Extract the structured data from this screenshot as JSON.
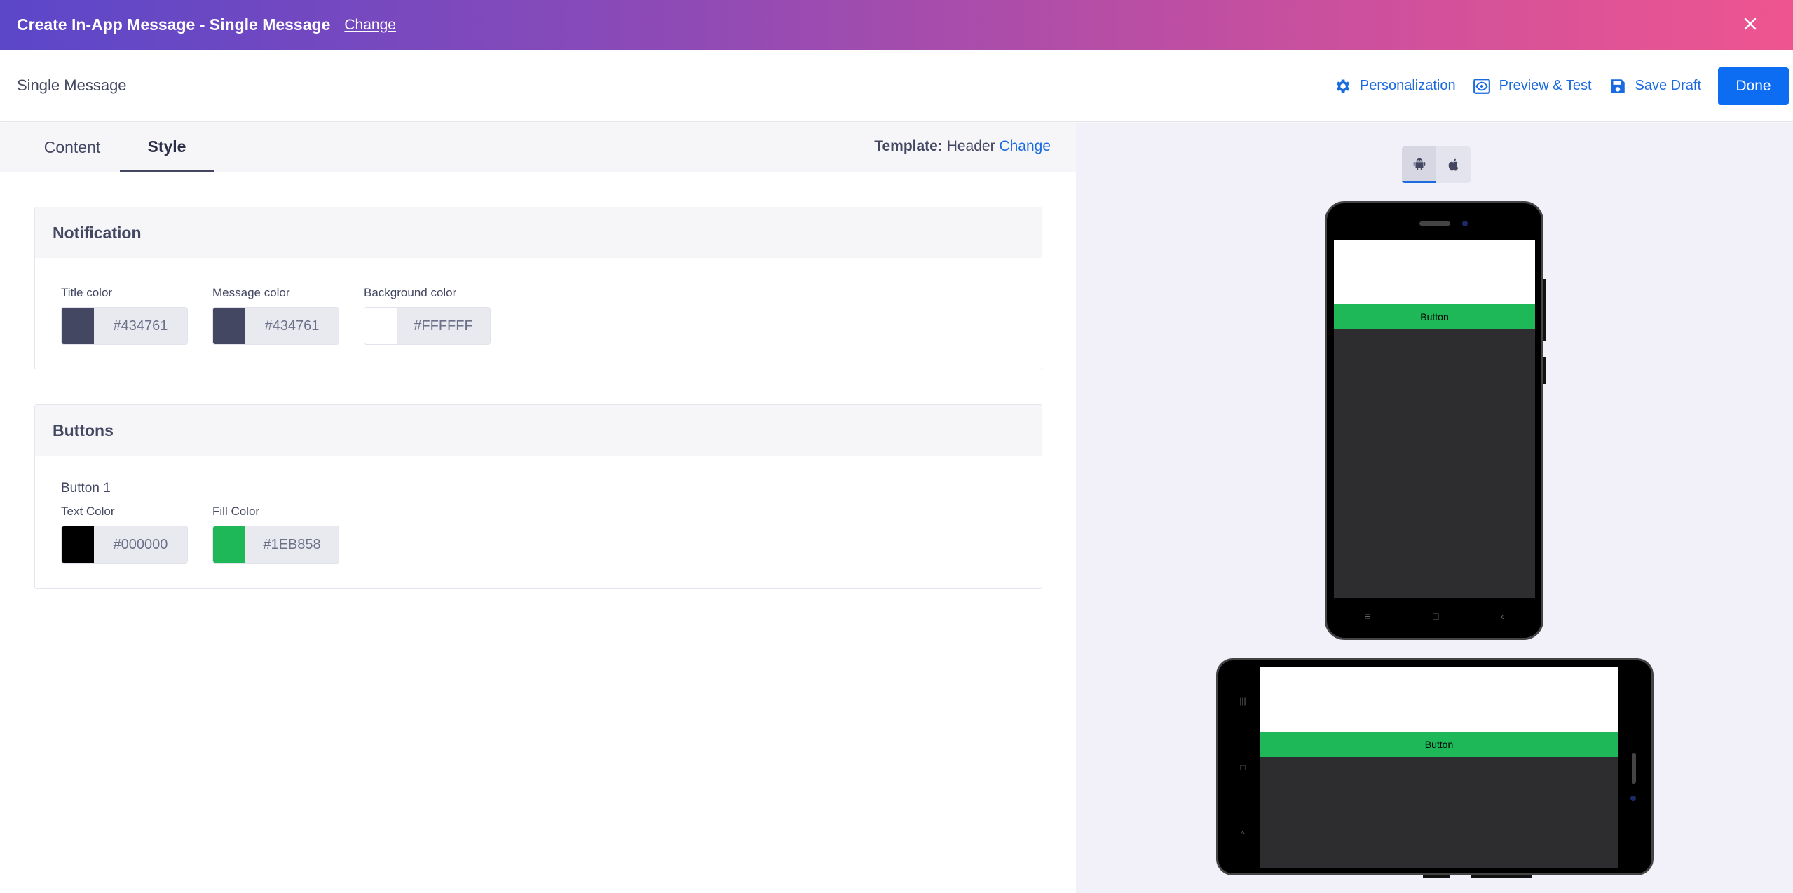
{
  "topbar": {
    "title": "Create In-App Message - Single Message",
    "change_label": "Change",
    "close_icon": "close-icon"
  },
  "header": {
    "page_title": "Single Message",
    "actions": [
      {
        "label": "Personalization",
        "icon": "gear-icon"
      },
      {
        "label": "Preview & Test",
        "icon": "eye-icon"
      },
      {
        "label": "Save Draft",
        "icon": "save-icon"
      }
    ],
    "done_label": "Done"
  },
  "tabs": [
    {
      "label": "Content",
      "active": false
    },
    {
      "label": "Style",
      "active": true
    }
  ],
  "template": {
    "label": "Template:",
    "value": "Header",
    "change_label": "Change"
  },
  "notification": {
    "heading": "Notification",
    "fields": [
      {
        "label": "Title color",
        "hex": "#434761",
        "color": "#434761"
      },
      {
        "label": "Message color",
        "hex": "#434761",
        "color": "#434761"
      },
      {
        "label": "Background color",
        "hex": "#FFFFFF",
        "color": "#FFFFFF"
      }
    ]
  },
  "buttons": {
    "heading": "Buttons",
    "button1_label": "Button 1",
    "fields": [
      {
        "label": "Text Color",
        "hex": "#000000",
        "color": "#000000"
      },
      {
        "label": "Fill Color",
        "hex": "#1EB858",
        "color": "#1EB858"
      }
    ]
  },
  "preview": {
    "os_options": [
      {
        "name": "android-icon",
        "active": true
      },
      {
        "name": "apple-icon",
        "active": false
      }
    ],
    "portrait_button_label": "Button",
    "landscape_button_label": "Button"
  },
  "colors": {
    "accent": "#1a6ae0",
    "done_bg": "#0d6df2",
    "button_fill": "#1eb858"
  }
}
